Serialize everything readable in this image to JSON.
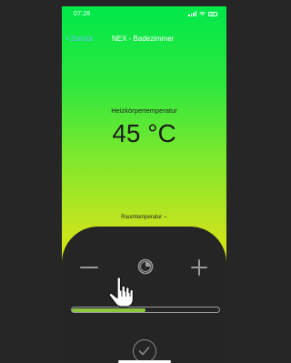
{
  "status_bar": {
    "time": "07:26"
  },
  "nav": {
    "back_label": "Zurück",
    "title": "NEX - Badezimmer"
  },
  "display": {
    "heating_label": "Heizkörpertemperatur",
    "temperature": "45 °C",
    "room_temp_label": "Raumtemperatur --"
  },
  "controls": {
    "slider_value_fraction": 0.5,
    "slider_color": "#8ec63f"
  },
  "icons": {
    "back": "chevron-left-icon",
    "minus": "minus-icon",
    "mode": "clock-icon",
    "plus": "plus-icon",
    "confirm": "checkmark-icon",
    "pointer": "hand-pointer-icon"
  },
  "colors": {
    "gradient_top": "#00e84a",
    "gradient_bottom": "#f7e600",
    "panel": "#252525",
    "link": "#6ac2ff"
  }
}
